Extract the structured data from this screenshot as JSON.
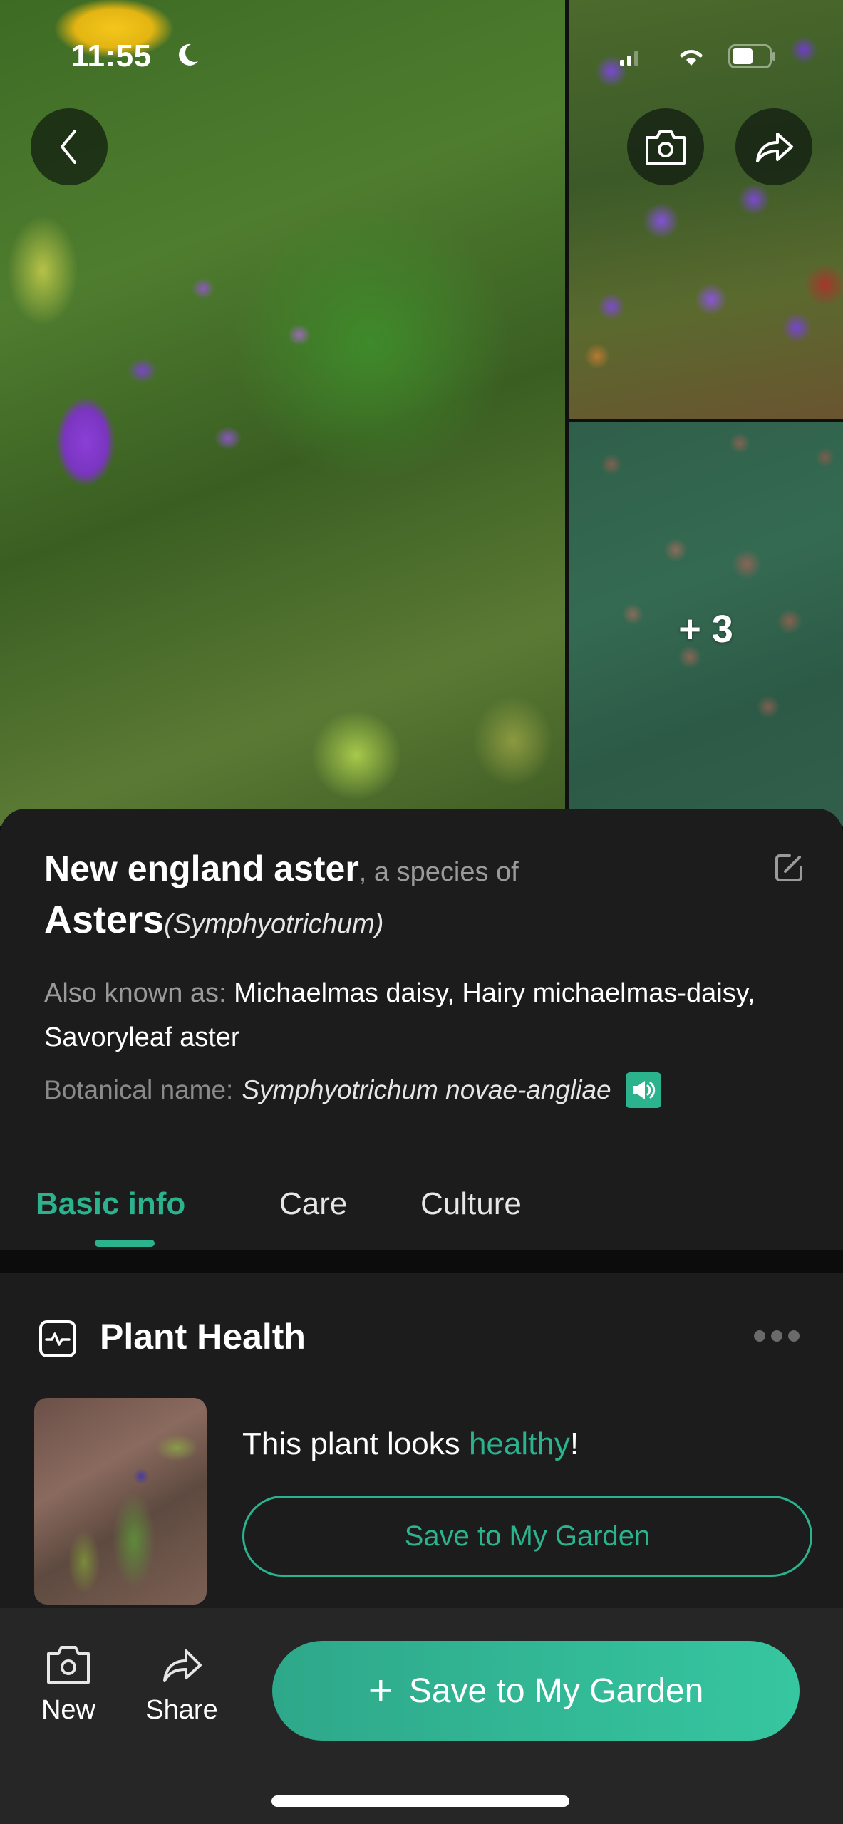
{
  "status_bar": {
    "time": "11:55",
    "icons": [
      "moon-icon",
      "signal-icon",
      "wifi-icon",
      "battery-icon"
    ]
  },
  "gallery": {
    "more_photos_label": "+ 3",
    "buttons": {
      "back": "chevron-left-icon",
      "camera": "camera-icon",
      "share": "share-icon"
    }
  },
  "plant": {
    "common_name": "New england aster",
    "species_of_text": ", a species of",
    "genus": "Asters",
    "genus_scientific": "(Symphyotrichum)",
    "also_known_as_label": "Also known as: ",
    "also_known_as": "Michaelmas daisy, Hairy michaelmas-daisy, Savoryleaf aster",
    "botanical_label": "Botanical name:",
    "botanical_name": "Symphyotrichum novae-angliae"
  },
  "tabs": [
    {
      "label": "Basic info",
      "active": true
    },
    {
      "label": "Care",
      "active": false
    },
    {
      "label": "Culture",
      "active": false
    }
  ],
  "plant_health": {
    "title": "Plant Health",
    "message_prefix": "This plant looks ",
    "status": "healthy",
    "message_suffix": "!",
    "save_button": "Save to My Garden"
  },
  "bottom_bar": {
    "new_label": "New",
    "share_label": "Share",
    "primary_button": "Save to My Garden",
    "primary_icon": "+"
  },
  "colors": {
    "accent": "#2bb38e",
    "sheet_background": "#1c1c1d",
    "bottom_bar_background": "#262627"
  }
}
